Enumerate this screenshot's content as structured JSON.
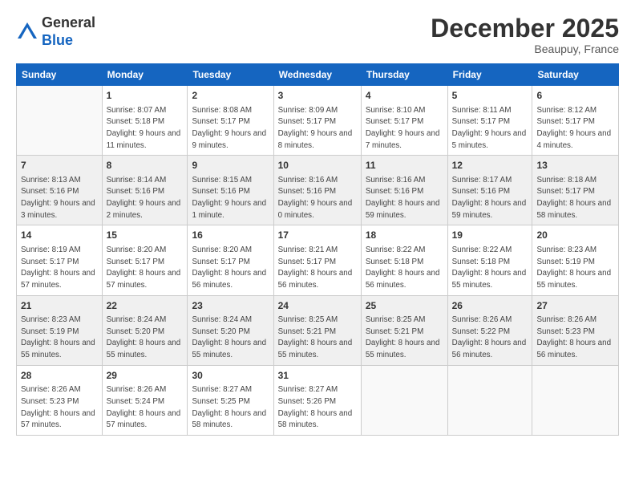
{
  "logo": {
    "general": "General",
    "blue": "Blue"
  },
  "header": {
    "month": "December 2025",
    "location": "Beaupuy, France"
  },
  "weekdays": [
    "Sunday",
    "Monday",
    "Tuesday",
    "Wednesday",
    "Thursday",
    "Friday",
    "Saturday"
  ],
  "weeks": [
    [
      {
        "day": "",
        "sunrise": "",
        "sunset": "",
        "daylight": "",
        "empty": true
      },
      {
        "day": "1",
        "sunrise": "Sunrise: 8:07 AM",
        "sunset": "Sunset: 5:18 PM",
        "daylight": "Daylight: 9 hours and 11 minutes."
      },
      {
        "day": "2",
        "sunrise": "Sunrise: 8:08 AM",
        "sunset": "Sunset: 5:17 PM",
        "daylight": "Daylight: 9 hours and 9 minutes."
      },
      {
        "day": "3",
        "sunrise": "Sunrise: 8:09 AM",
        "sunset": "Sunset: 5:17 PM",
        "daylight": "Daylight: 9 hours and 8 minutes."
      },
      {
        "day": "4",
        "sunrise": "Sunrise: 8:10 AM",
        "sunset": "Sunset: 5:17 PM",
        "daylight": "Daylight: 9 hours and 7 minutes."
      },
      {
        "day": "5",
        "sunrise": "Sunrise: 8:11 AM",
        "sunset": "Sunset: 5:17 PM",
        "daylight": "Daylight: 9 hours and 5 minutes."
      },
      {
        "day": "6",
        "sunrise": "Sunrise: 8:12 AM",
        "sunset": "Sunset: 5:17 PM",
        "daylight": "Daylight: 9 hours and 4 minutes."
      }
    ],
    [
      {
        "day": "7",
        "sunrise": "Sunrise: 8:13 AM",
        "sunset": "Sunset: 5:16 PM",
        "daylight": "Daylight: 9 hours and 3 minutes."
      },
      {
        "day": "8",
        "sunrise": "Sunrise: 8:14 AM",
        "sunset": "Sunset: 5:16 PM",
        "daylight": "Daylight: 9 hours and 2 minutes."
      },
      {
        "day": "9",
        "sunrise": "Sunrise: 8:15 AM",
        "sunset": "Sunset: 5:16 PM",
        "daylight": "Daylight: 9 hours and 1 minute."
      },
      {
        "day": "10",
        "sunrise": "Sunrise: 8:16 AM",
        "sunset": "Sunset: 5:16 PM",
        "daylight": "Daylight: 9 hours and 0 minutes."
      },
      {
        "day": "11",
        "sunrise": "Sunrise: 8:16 AM",
        "sunset": "Sunset: 5:16 PM",
        "daylight": "Daylight: 8 hours and 59 minutes."
      },
      {
        "day": "12",
        "sunrise": "Sunrise: 8:17 AM",
        "sunset": "Sunset: 5:16 PM",
        "daylight": "Daylight: 8 hours and 59 minutes."
      },
      {
        "day": "13",
        "sunrise": "Sunrise: 8:18 AM",
        "sunset": "Sunset: 5:17 PM",
        "daylight": "Daylight: 8 hours and 58 minutes."
      }
    ],
    [
      {
        "day": "14",
        "sunrise": "Sunrise: 8:19 AM",
        "sunset": "Sunset: 5:17 PM",
        "daylight": "Daylight: 8 hours and 57 minutes."
      },
      {
        "day": "15",
        "sunrise": "Sunrise: 8:20 AM",
        "sunset": "Sunset: 5:17 PM",
        "daylight": "Daylight: 8 hours and 57 minutes."
      },
      {
        "day": "16",
        "sunrise": "Sunrise: 8:20 AM",
        "sunset": "Sunset: 5:17 PM",
        "daylight": "Daylight: 8 hours and 56 minutes."
      },
      {
        "day": "17",
        "sunrise": "Sunrise: 8:21 AM",
        "sunset": "Sunset: 5:17 PM",
        "daylight": "Daylight: 8 hours and 56 minutes."
      },
      {
        "day": "18",
        "sunrise": "Sunrise: 8:22 AM",
        "sunset": "Sunset: 5:18 PM",
        "daylight": "Daylight: 8 hours and 56 minutes."
      },
      {
        "day": "19",
        "sunrise": "Sunrise: 8:22 AM",
        "sunset": "Sunset: 5:18 PM",
        "daylight": "Daylight: 8 hours and 55 minutes."
      },
      {
        "day": "20",
        "sunrise": "Sunrise: 8:23 AM",
        "sunset": "Sunset: 5:19 PM",
        "daylight": "Daylight: 8 hours and 55 minutes."
      }
    ],
    [
      {
        "day": "21",
        "sunrise": "Sunrise: 8:23 AM",
        "sunset": "Sunset: 5:19 PM",
        "daylight": "Daylight: 8 hours and 55 minutes."
      },
      {
        "day": "22",
        "sunrise": "Sunrise: 8:24 AM",
        "sunset": "Sunset: 5:20 PM",
        "daylight": "Daylight: 8 hours and 55 minutes."
      },
      {
        "day": "23",
        "sunrise": "Sunrise: 8:24 AM",
        "sunset": "Sunset: 5:20 PM",
        "daylight": "Daylight: 8 hours and 55 minutes."
      },
      {
        "day": "24",
        "sunrise": "Sunrise: 8:25 AM",
        "sunset": "Sunset: 5:21 PM",
        "daylight": "Daylight: 8 hours and 55 minutes."
      },
      {
        "day": "25",
        "sunrise": "Sunrise: 8:25 AM",
        "sunset": "Sunset: 5:21 PM",
        "daylight": "Daylight: 8 hours and 55 minutes."
      },
      {
        "day": "26",
        "sunrise": "Sunrise: 8:26 AM",
        "sunset": "Sunset: 5:22 PM",
        "daylight": "Daylight: 8 hours and 56 minutes."
      },
      {
        "day": "27",
        "sunrise": "Sunrise: 8:26 AM",
        "sunset": "Sunset: 5:23 PM",
        "daylight": "Daylight: 8 hours and 56 minutes."
      }
    ],
    [
      {
        "day": "28",
        "sunrise": "Sunrise: 8:26 AM",
        "sunset": "Sunset: 5:23 PM",
        "daylight": "Daylight: 8 hours and 57 minutes."
      },
      {
        "day": "29",
        "sunrise": "Sunrise: 8:26 AM",
        "sunset": "Sunset: 5:24 PM",
        "daylight": "Daylight: 8 hours and 57 minutes."
      },
      {
        "day": "30",
        "sunrise": "Sunrise: 8:27 AM",
        "sunset": "Sunset: 5:25 PM",
        "daylight": "Daylight: 8 hours and 58 minutes."
      },
      {
        "day": "31",
        "sunrise": "Sunrise: 8:27 AM",
        "sunset": "Sunset: 5:26 PM",
        "daylight": "Daylight: 8 hours and 58 minutes."
      },
      {
        "day": "",
        "empty": true
      },
      {
        "day": "",
        "empty": true
      },
      {
        "day": "",
        "empty": true
      }
    ]
  ]
}
